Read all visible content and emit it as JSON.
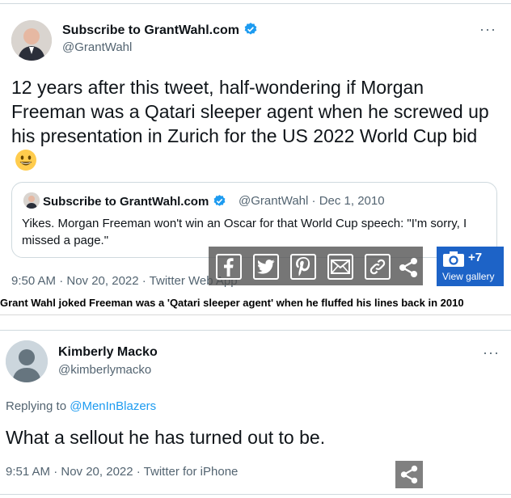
{
  "tweet1": {
    "author_name": "Subscribe to GrantWahl.com",
    "handle": "@GrantWahl",
    "more_label": "···",
    "text": "12 years after this tweet, half-wondering if Morgan Freeman was a Qatari sleeper agent when he screwed up his presentation in Zurich for the US 2022 World Cup bid",
    "emoji_icon": "grinning-face-icon",
    "timestamp": "9:50 AM · Nov 20, 2022 · Twitter Web App",
    "quote": {
      "author_name": "Subscribe to GrantWahl.com",
      "meta": "@GrantWahl · Dec 1, 2010",
      "text": "Yikes. Morgan Freeman won't win an Oscar for that World Cup speech: \"I'm sorry, I missed a page.\""
    }
  },
  "share_overlay": {
    "icons": [
      "facebook-icon",
      "twitter-icon",
      "pinterest-icon",
      "email-icon",
      "link-icon",
      "share-icon"
    ],
    "gallery_count": "+7",
    "gallery_label": "View gallery"
  },
  "caption": "Grant Wahl joked Freeman was a 'Qatari sleeper agent' when he fluffed his lines back in 2010",
  "tweet2": {
    "author_name": "Kimberly Macko",
    "handle": "@kimberlymacko",
    "more_label": "···",
    "replying_prefix": "Replying to ",
    "replying_to": "@MenInBlazers",
    "text": "What a sellout he has turned out to be.",
    "timestamp": "9:51 AM · Nov 20, 2022 · Twitter for iPhone"
  },
  "colors": {
    "verified": "#1d9bf0",
    "link": "#1d9bf0",
    "gallery_button": "#1d63c7",
    "secondary_text": "#536471"
  }
}
